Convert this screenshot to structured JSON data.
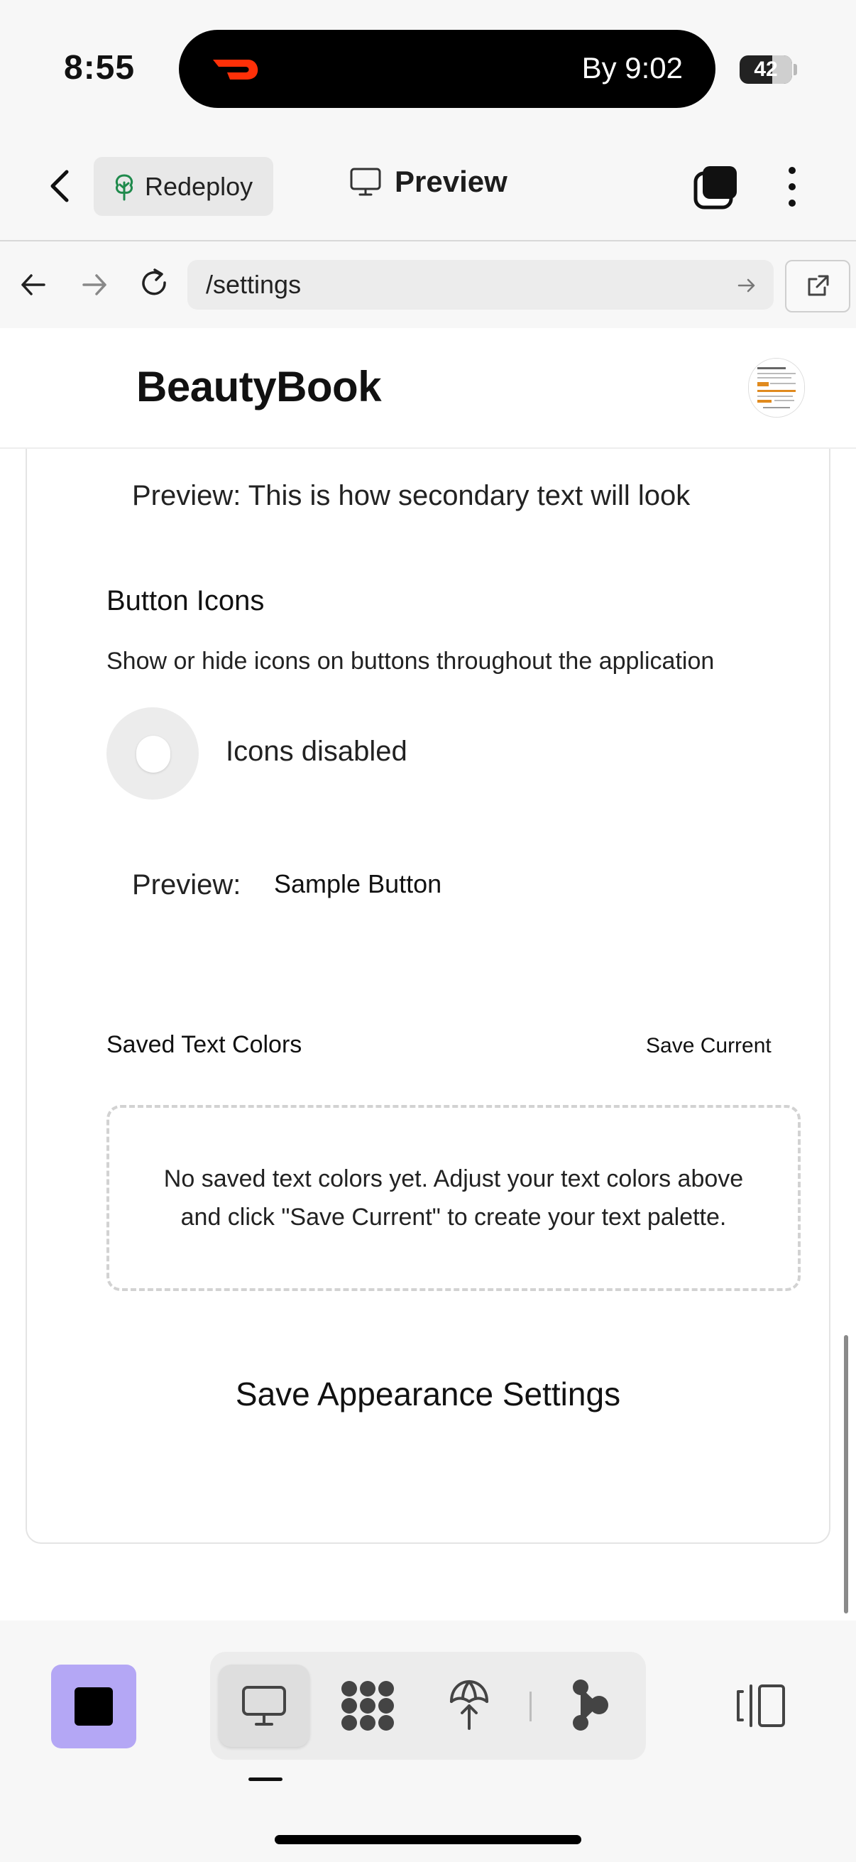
{
  "status_bar": {
    "time": "8:55",
    "live_activity_eta": "By 9:02",
    "battery": "42"
  },
  "app_header": {
    "redeploy_label": "Redeploy",
    "preview_label": "Preview"
  },
  "browser": {
    "url": "/settings"
  },
  "site": {
    "title": "BeautyBook"
  },
  "settings": {
    "secondary_text_preview": "Preview: This is how secondary text will look",
    "secondary_swatch_color": "#64748b",
    "button_icons": {
      "heading": "Button Icons",
      "description": "Show or hide icons on buttons throughout the application",
      "state_label": "Icons disabled",
      "enabled": false,
      "preview_label": "Preview:",
      "sample_button_label": "Sample Button"
    },
    "saved_text_colors": {
      "heading": "Saved Text Colors",
      "save_current_label": "Save Current",
      "empty_message": "No saved text colors yet. Adjust your text colors above and click \"Save Current\" to create your text palette."
    },
    "save_button_label": "Save Appearance Settings"
  },
  "toolbar": {
    "stop_button_color": "#b4a7f5",
    "tools": [
      "desktop-icon",
      "apps-grid-icon",
      "deploy-icon",
      "share-nodes-icon"
    ],
    "active_tool": "desktop-icon"
  }
}
